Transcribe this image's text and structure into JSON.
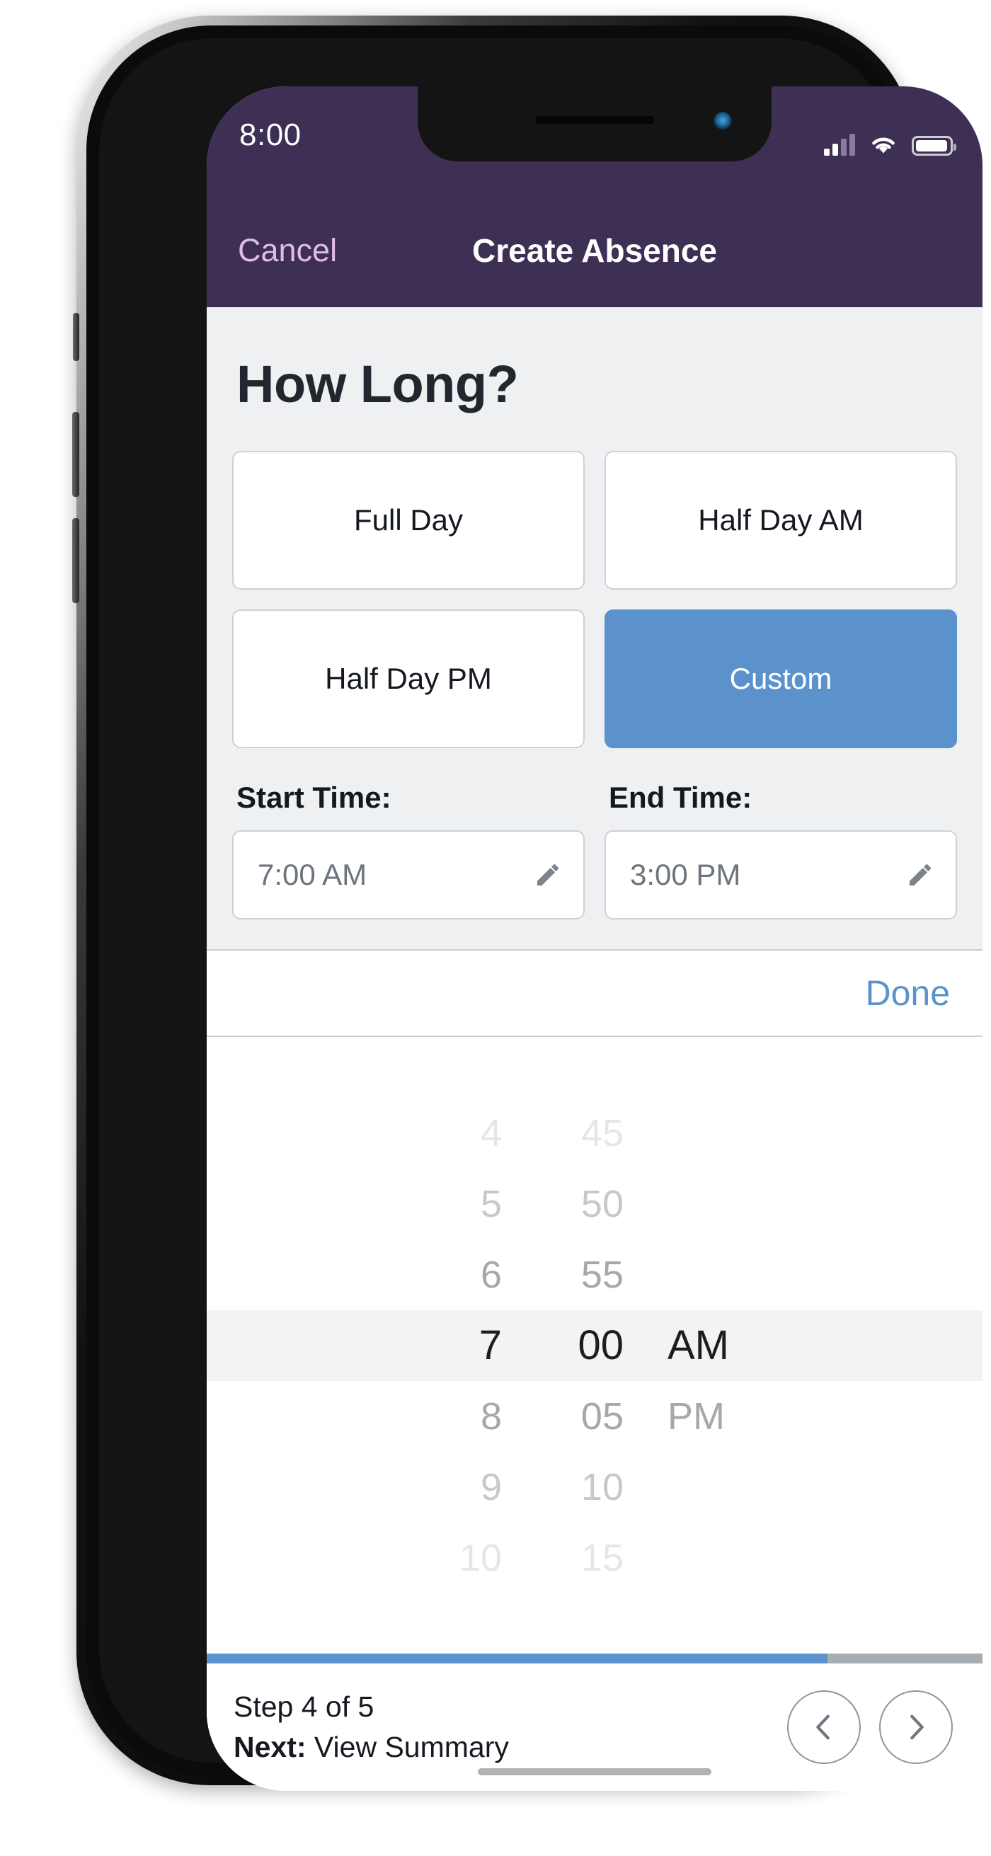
{
  "status_bar": {
    "time": "8:00",
    "signal_icon": "signal-bars-icon",
    "wifi_icon": "wifi-icon",
    "battery_icon": "battery-full-icon"
  },
  "nav_bar": {
    "cancel_label": "Cancel",
    "title": "Create Absence"
  },
  "page": {
    "title": "How Long?"
  },
  "duration_options": [
    {
      "label": "Full Day",
      "selected": false
    },
    {
      "label": "Half Day AM",
      "selected": false
    },
    {
      "label": "Half Day PM",
      "selected": false
    },
    {
      "label": "Custom",
      "selected": true
    }
  ],
  "time_fields": {
    "start": {
      "label": "Start Time:",
      "value": "7:00 AM",
      "edit_icon": "pencil-icon"
    },
    "end": {
      "label": "End Time:",
      "value": "3:00 PM",
      "edit_icon": "pencil-icon"
    }
  },
  "picker": {
    "done_label": "Done",
    "hours": [
      "4",
      "5",
      "6",
      "7",
      "8",
      "9",
      "10"
    ],
    "minutes": [
      "45",
      "50",
      "55",
      "00",
      "05",
      "10",
      "15"
    ],
    "periods": [
      "",
      "",
      "",
      "AM",
      "PM",
      "",
      ""
    ],
    "selected": {
      "hour": "7",
      "minute": "00",
      "period": "AM"
    }
  },
  "footer": {
    "step_text": "Step 4 of 5",
    "next_prefix": "Next:",
    "next_value": " View Summary",
    "progress_percent": 80,
    "prev_icon": "chevron-left-icon",
    "next_icon": "chevron-right-icon"
  },
  "colors": {
    "header_purple": "#3e3054",
    "accent_blue": "#5c92cb",
    "cancel_link": "#e0bce6",
    "page_bg": "#eef0f2",
    "border_gray": "#cdd2d8",
    "progress_track": "#a8adb4"
  }
}
